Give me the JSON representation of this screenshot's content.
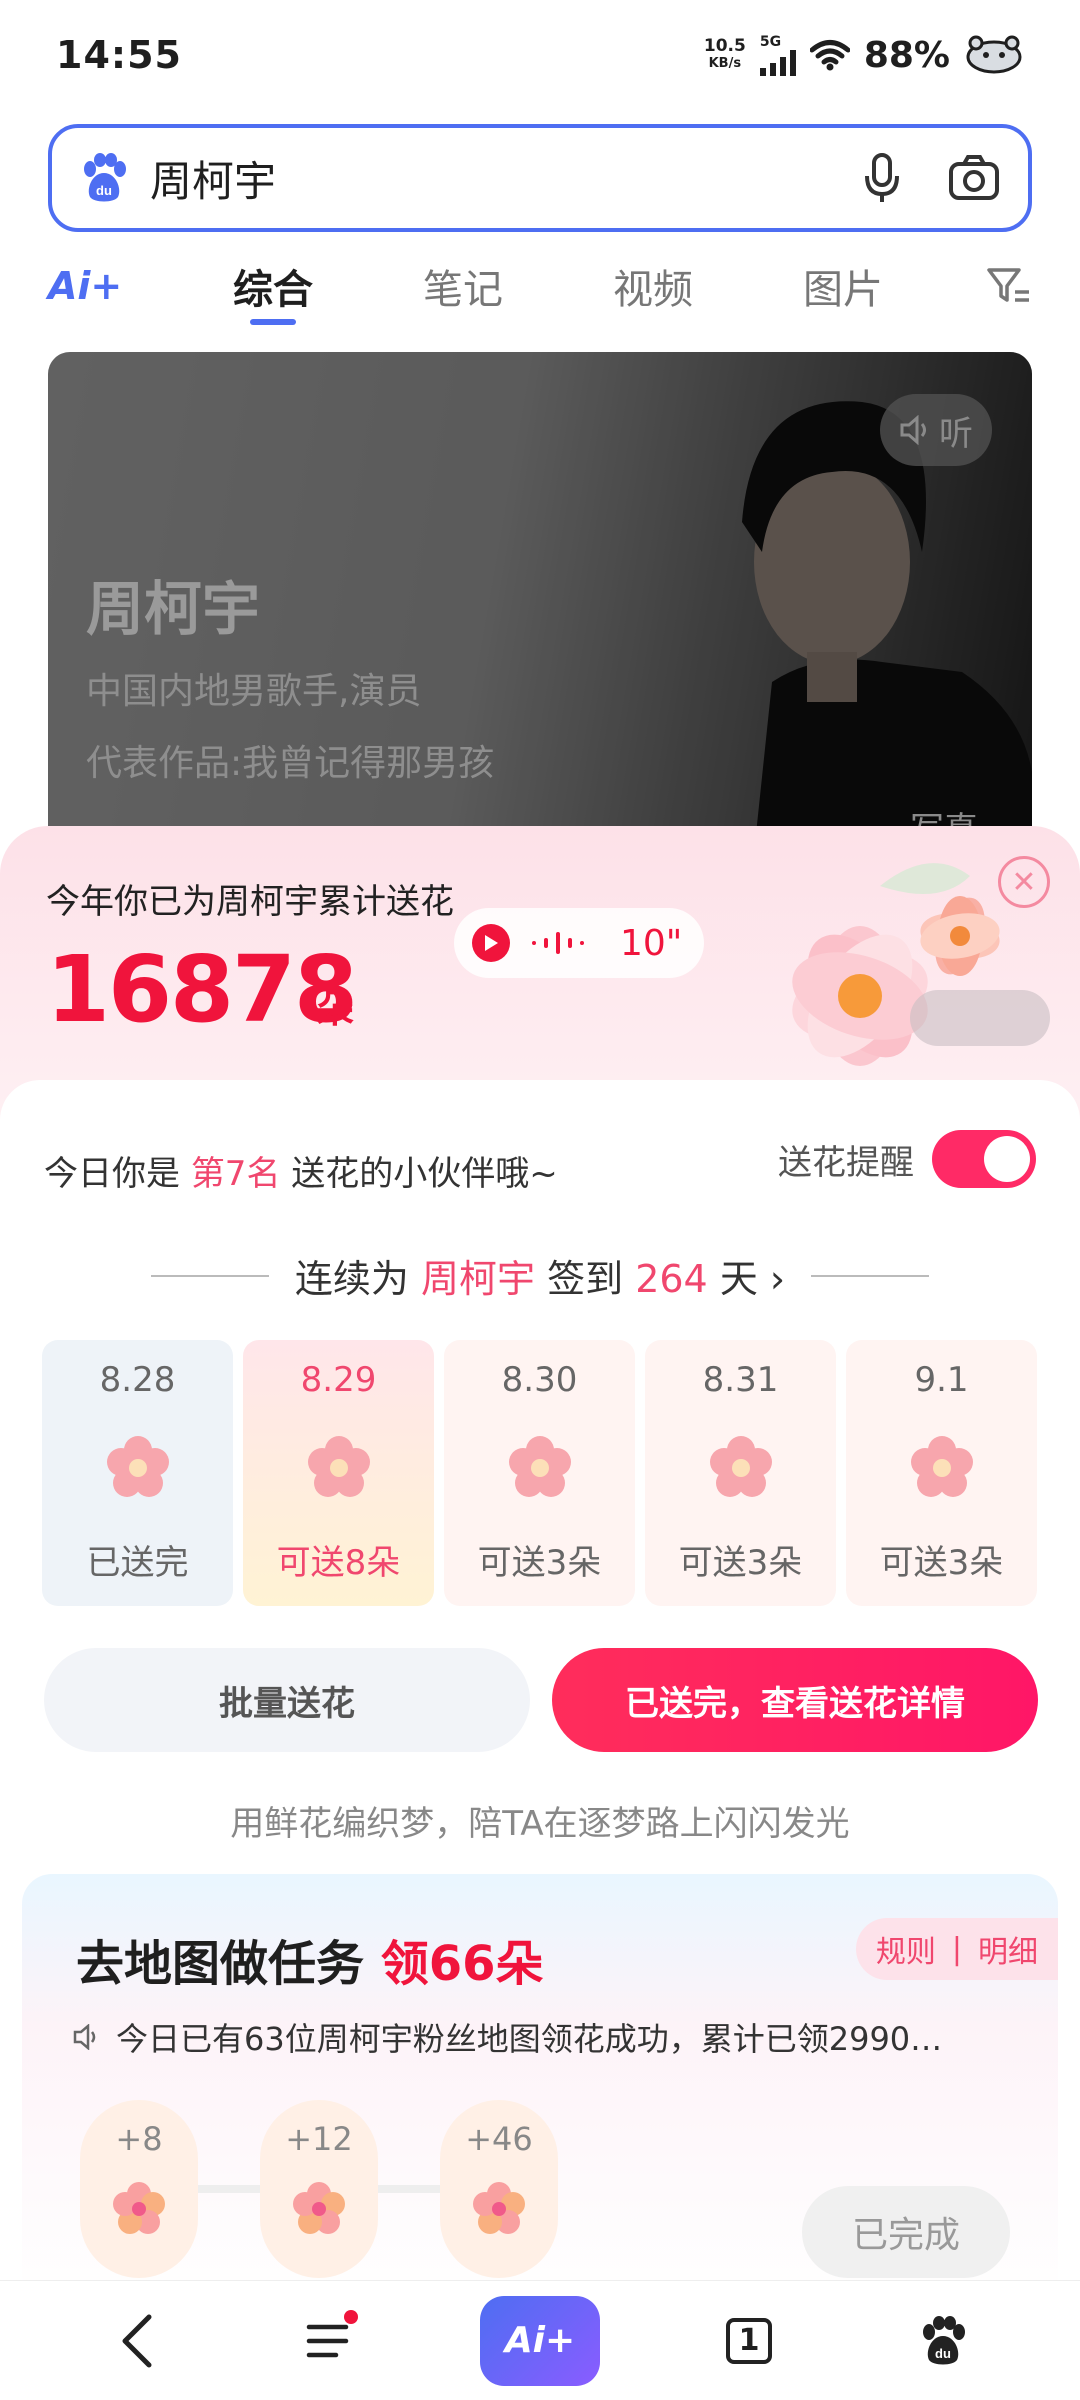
{
  "status_bar": {
    "time": "14:55",
    "net_speed": "10.5",
    "net_unit": "KB/s",
    "net_type": "5G",
    "battery": "88%"
  },
  "search": {
    "query": "周柯宇"
  },
  "tabs": {
    "ai_label": "Ai+",
    "items": [
      "综合",
      "笔记",
      "视频",
      "图片"
    ],
    "active": "综合"
  },
  "hero": {
    "name": "周柯宇",
    "subtitle": "中国内地男歌手,演员",
    "works": "代表作品:我曾记得那男孩",
    "listen": "听",
    "tag": "写真"
  },
  "flower_sheet": {
    "title": "今年你已为周柯宇累计送花",
    "count": "16878",
    "unit": "朵",
    "voice_duration": "10\"",
    "rank_prefix": "今日你是",
    "rank": "第7名",
    "rank_suffix": "送花的小伙伴哦~",
    "remind_label": "送花提醒",
    "remind_on": true,
    "streak_prefix": "连续为",
    "streak_name": "周柯宇",
    "streak_mid": "签到",
    "streak_days": "264",
    "streak_suffix": "天",
    "days": [
      {
        "date": "8.28",
        "status": "已送完"
      },
      {
        "date": "8.29",
        "status": "可送8朵"
      },
      {
        "date": "8.30",
        "status": "可送3朵"
      },
      {
        "date": "8.31",
        "status": "可送3朵"
      },
      {
        "date": "9.1",
        "status": "可送3朵"
      }
    ],
    "batch_button": "批量送花",
    "detail_button": "已送完，查看送花详情",
    "slogan": "用鲜花编织梦，陪TA在逐梦路上闪闪发光"
  },
  "task": {
    "title": "去地图做任务",
    "title_highlight": "领66朵",
    "rules": "规则",
    "detail": "明细",
    "news": "今日已有63位周柯宇粉丝地图领花成功，累计已领2990…",
    "steps": [
      "+8",
      "+12",
      "+46"
    ],
    "done_button": "已完成"
  },
  "bottom_nav": {
    "ai_label": "Ai+",
    "tabs_count": "1"
  },
  "colors": {
    "accent": "#f0143c",
    "brand_blue": "#4e6ef2",
    "toggle": "#ff2a66"
  }
}
